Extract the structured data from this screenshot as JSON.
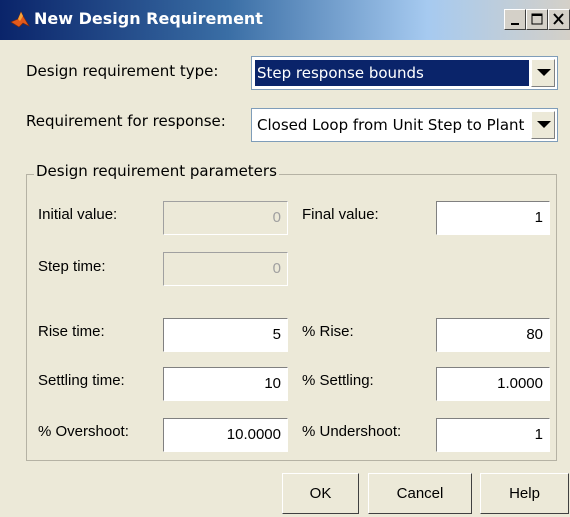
{
  "window": {
    "title": "New Design Requirement"
  },
  "form": {
    "requirement_type_label": "Design requirement type:",
    "requirement_type_value": "Step response bounds",
    "response_label": "Requirement for response:",
    "response_value": "Closed Loop from Unit Step to Plant"
  },
  "params": {
    "group_title": "Design requirement parameters",
    "initial_value": {
      "label": "Initial value:",
      "value": "0"
    },
    "final_value": {
      "label": "Final value:",
      "value": "1"
    },
    "step_time": {
      "label": "Step time:",
      "value": "0"
    },
    "rise_time": {
      "label": "Rise time:",
      "value": "5"
    },
    "pct_rise": {
      "label": "% Rise:",
      "value": "80"
    },
    "settling_time": {
      "label": "Settling time:",
      "value": "10"
    },
    "pct_settling": {
      "label": "% Settling:",
      "value": "1.0000"
    },
    "pct_overshoot": {
      "label": "% Overshoot:",
      "value": "10.0000"
    },
    "pct_undershoot": {
      "label": "% Undershoot:",
      "value": "1"
    }
  },
  "buttons": {
    "ok": "OK",
    "cancel": "Cancel",
    "help": "Help"
  },
  "colors": {
    "title_active": "#0a246a",
    "selection": "#0a246a",
    "dialog_bg": "#ece9d8"
  },
  "icons": [
    "matlab-logo-icon",
    "minimize-icon",
    "maximize-icon",
    "close-icon",
    "dropdown-arrow-icon"
  ]
}
